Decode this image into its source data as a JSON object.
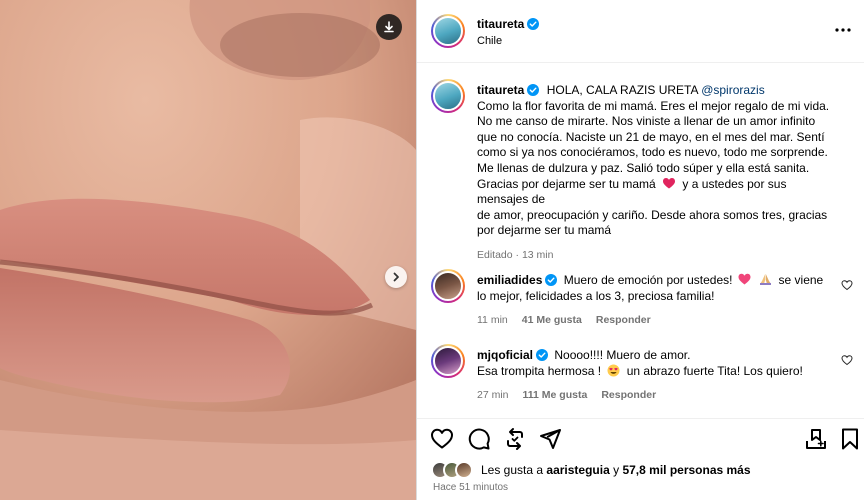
{
  "post": {
    "author": "titaureta",
    "location": "Chile"
  },
  "caption": {
    "author": "titaureta",
    "headline": "HOLA, CALA RAZIS URETA",
    "mention": "@spirorazis",
    "lines": [
      "Como la flor favorita de mi mamá. Eres el mejor regalo de mi vida.",
      "No me canso de mirarte. Nos viniste a llenar de un amor infinito",
      "que no conocía. Naciste un 21 de mayo, en el mes del mar. Sentí",
      "como si ya nos conociéramos, todo es nuevo, todo me sorprende.",
      "Me llenas de dulzura y paz. Salió todo súper y ella está sanita.",
      "Gracias por dejarme ser tu mamá",
      "y a ustedes por sus mensajes de",
      "de amor, preocupación y cariño. Desde ahora somos tres, gracias",
      "por dejarme ser tu mamá"
    ],
    "line6_emoji": "❤️",
    "meta": "Editado · 13 min"
  },
  "comments": [
    {
      "author": "emiliadides",
      "text1": "Muero de emoción por ustedes!",
      "emoji1": "💖",
      "emoji2": "🙏",
      "text2": "se viene",
      "line2": "lo mejor, felicidades a los 3, preciosa familia!",
      "time": "11 min",
      "likes": "41 Me gusta",
      "reply": "Responder"
    },
    {
      "author": "mjqoficial",
      "text1": "Noooo!!!! Muero de amor.",
      "line2a": "Esa trompita hermosa !",
      "emoji1": "😍",
      "line2b": "un abrazo fuerte Tita! Los quiero!",
      "time": "27 min",
      "likes": "111 Me gusta",
      "reply": "Responder"
    }
  ],
  "likes": {
    "prefix": "Les gusta a",
    "user": "aaristeguia",
    "and": "y",
    "count": "57,8 mil personas más"
  },
  "posted_ago": "Hace 51 minutos",
  "icons": [
    "download-icon",
    "chevron-right-icon",
    "verified-icon",
    "more-icon",
    "heart-icon",
    "comment-icon",
    "repost-icon",
    "share-icon",
    "save-to-collection-icon",
    "bookmark-icon"
  ],
  "colors": {
    "verified": "#0095f6",
    "link": "#00376b",
    "muted": "#737373"
  }
}
